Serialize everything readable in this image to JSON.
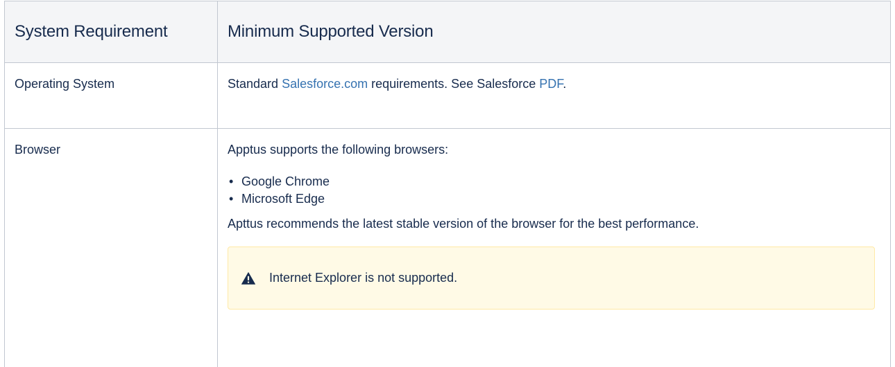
{
  "table": {
    "headers": {
      "requirement": "System Requirement",
      "version": "Minimum Supported Version"
    },
    "rows": {
      "os": {
        "label": "Operating System",
        "text_before": "Standard ",
        "link1": "Salesforce.com",
        "text_middle": " requirements. See Salesforce ",
        "link2": "PDF",
        "text_after": "."
      },
      "browser": {
        "label": "Browser",
        "intro": "Apptus supports the following browsers:",
        "bullet": "•",
        "items": [
          "Google Chrome",
          "Microsoft Edge"
        ],
        "recommendation": "Apttus recommends the latest stable version of the browser for the best performance.",
        "warning": {
          "icon": "warning-icon",
          "text": "Internet Explorer is not supported."
        }
      }
    }
  },
  "colors": {
    "link": "#3572b0",
    "header_bg": "#f4f5f7",
    "warning_bg": "#fffae6",
    "warning_border": "#ffe9a6",
    "warning_icon": "#172b4d"
  }
}
